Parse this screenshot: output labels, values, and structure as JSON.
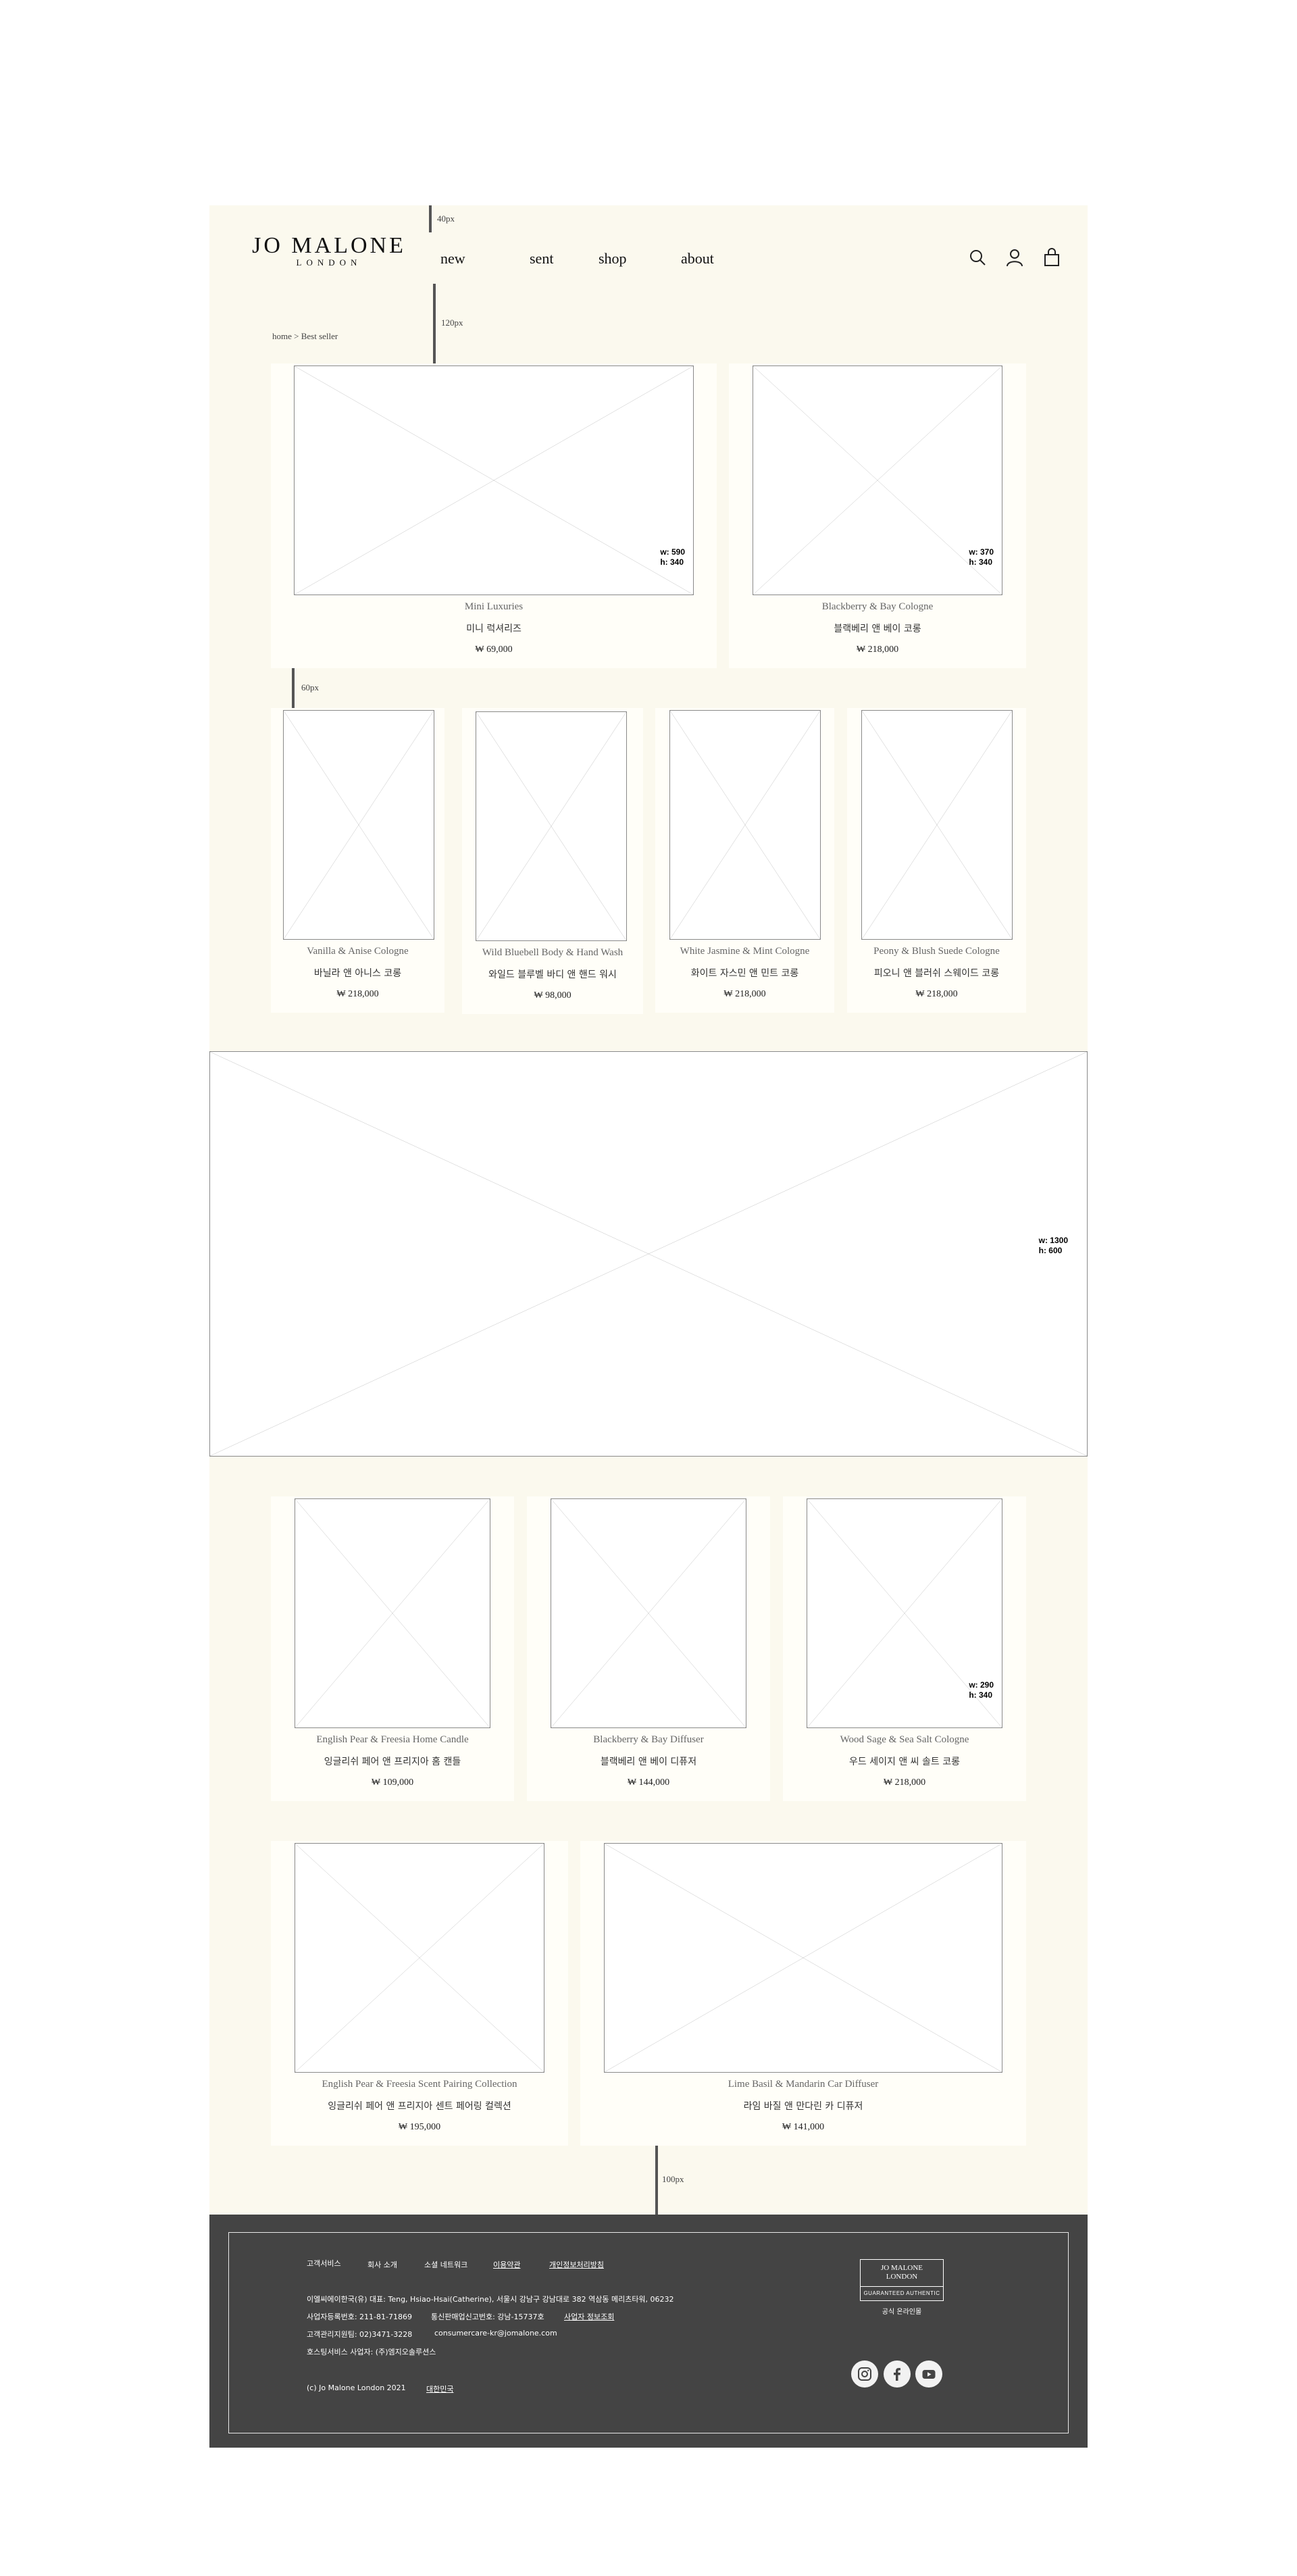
{
  "header": {
    "logo_main": "JO MALONE",
    "logo_sub": "LONDON",
    "nav": [
      "new",
      "sent",
      "shop",
      "about"
    ],
    "icons": [
      "search-icon",
      "user-icon",
      "bag-icon"
    ]
  },
  "annotations": {
    "top_margin": "40px",
    "breadcrumb_gap": "120px",
    "row_gap": "60px",
    "footer_gap": "100px"
  },
  "breadcrumb": "home > Best seller",
  "row1": [
    {
      "name": "Mini Luxuries",
      "kor": "미니 럭셔리즈",
      "price": "₩ 69,000",
      "dim_w": "w: 590",
      "dim_h": "h: 340"
    },
    {
      "name": "Blackberry & Bay Cologne",
      "kor": "블랙베리 앤 베이 코롱",
      "price": "₩ 218,000",
      "dim_w": "w: 370",
      "dim_h": "h: 340"
    }
  ],
  "row2": [
    {
      "name": "Vanilla & Anise Cologne",
      "kor": "바닐라 앤 아니스 코롱",
      "price": "₩ 218,000"
    },
    {
      "name": "Wild Bluebell Body & Hand Wash",
      "kor": "와일드 블루벨 바디 앤 핸드 워시",
      "price": "₩ 98,000"
    },
    {
      "name": "White Jasmine & Mint Cologne",
      "kor": "화이트 자스민 앤 민트 코롱",
      "price": "₩ 218,000"
    },
    {
      "name": "Peony & Blush Suede Cologne",
      "kor": "피오니 앤 블러쉬 스웨이드 코롱",
      "price": "₩ 218,000"
    }
  ],
  "banner": {
    "dim_w": "w: 1300",
    "dim_h": "h: 600"
  },
  "row3": [
    {
      "name": "English Pear & Freesia Home Candle",
      "kor": "잉글리쉬 페어 앤 프리지아 홈 캔들",
      "price": "₩ 109,000"
    },
    {
      "name": "Blackberry & Bay Diffuser",
      "kor": "블랙베리 앤 베이 디퓨저",
      "price": "₩ 144,000"
    },
    {
      "name": "Wood Sage & Sea Salt Cologne",
      "kor": "우드 세이지 앤 씨 솔트 코롱",
      "price": "₩ 218,000",
      "dim_w": "w: 290",
      "dim_h": "h: 340"
    }
  ],
  "row4": [
    {
      "name": "English Pear & Freesia Scent Pairing Collection",
      "kor": "잉글리쉬 페어 앤 프리지아 센트 페어링 컬렉션",
      "price": "₩ 195,000"
    },
    {
      "name": "Lime Basil & Mandarin Car Diffuser",
      "kor": "라임 바질 앤 만다린 카 디퓨저",
      "price": "₩ 141,000"
    }
  ],
  "footer": {
    "links": [
      "고객서비스",
      "회사 소개",
      "소셜 네트워크",
      "이용약관",
      "개인정보처리방침"
    ],
    "company": "이엘씨에이한국(유) 대표: Teng, Hsiao-Hsai(Catherine), 서울시 강남구 강남대로 382 역삼동 메리츠타워, 06232",
    "biz_no": "사업자등록번호: 211-81-71869",
    "mail_order": "통신판매업신고번호: 강남-15737호",
    "biz_info": "사업자 정보조회",
    "phone": "고객관리지원팀: 02)3471-3228",
    "email": "consumercare-kr@jomalone.com",
    "hosting": "호스팅서비스 사업자: (주)엠지오솔루션스",
    "copyright": "(c) Jo Malone London 2021",
    "country": "대한민국",
    "badge_top": "JO MALONE\nLONDON",
    "badge_bottom": "GUARANTEED AUTHENTIC",
    "badge_caption": "공식 온라인몰",
    "social": [
      "instagram-icon",
      "facebook-icon",
      "youtube-icon"
    ]
  }
}
